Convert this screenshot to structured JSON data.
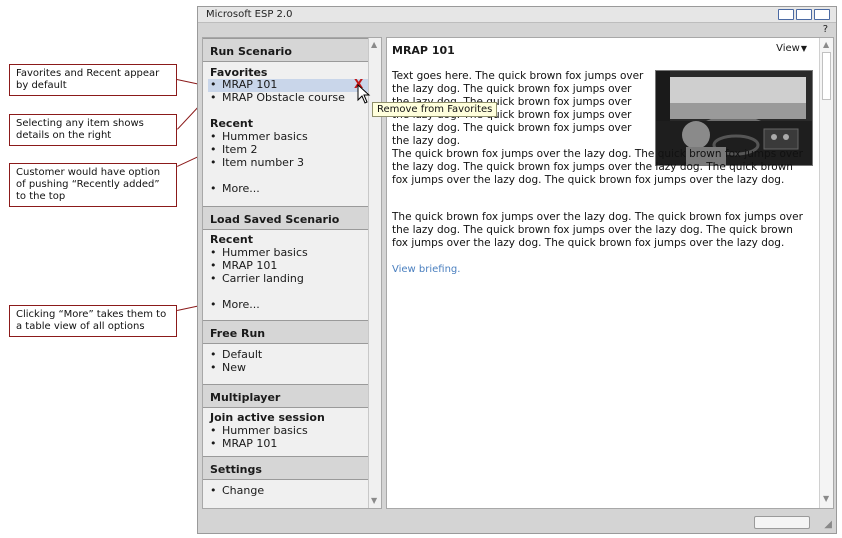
{
  "window": {
    "title": "Microsoft ESP 2.0",
    "help_label": "?"
  },
  "callouts": [
    "Favorites and Recent appear by default",
    "Selecting any item shows details on the right",
    "Customer would have option of pushing “Recently added” to the top",
    "Clicking “More” takes them to a table view of all options"
  ],
  "left_pane": {
    "run_scenario": {
      "header": "Run Scenario",
      "favorites_title": "Favorites",
      "favorites": [
        "MRAP 101",
        "MRAP Obstacle course"
      ],
      "remove_glyph": "X",
      "recent_title": "Recent",
      "recent": [
        "Hummer basics",
        "Item 2",
        "Item number 3"
      ],
      "more": "More..."
    },
    "load_saved": {
      "header": "Load Saved  Scenario",
      "recent_title": "Recent",
      "recent": [
        "Hummer basics",
        "MRAP 101",
        "Carrier landing"
      ],
      "more": "More..."
    },
    "free_run": {
      "header": "Free Run",
      "items": [
        "Default",
        "New"
      ]
    },
    "multiplayer": {
      "header": "Multiplayer",
      "join_title": "Join active session",
      "items": [
        "Hummer basics",
        "MRAP 101"
      ]
    },
    "settings": {
      "header": "Settings",
      "items": [
        "Change"
      ]
    },
    "bullet": "•"
  },
  "tooltip": "Remove from Favorites",
  "right_pane": {
    "title": "MRAP 101",
    "view_label": "View",
    "para1": "Text goes here.  The quick  brown fox jumps  over the lazy dog. The quick brown fox jumps over the lazy dog. The  quick  brown  fox  jumps  over  the  lazy  dog. The  quick  brown fox jumps over  the  lazy dog. The quick brown fox jumps over the lazy dog.",
    "para2": "The quick brown fox jumps over the lazy dog. The quick brown fox jumps over the lazy dog. The quick brown fox jumps over the lazy dog. The quick brown fox jumps over the lazy dog. The quick brown fox jumps over the lazy dog.",
    "para3": "The quick brown fox jumps over the lazy dog. The quick brown fox jumps over the lazy dog. The quick brown fox jumps over the lazy dog. The quick brown fox jumps over the lazy dog. The quick brown fox jumps over the lazy dog.",
    "link": "View briefing."
  },
  "colors": {
    "accent_link": "#4a7fbf",
    "callout_border": "#8b1a1a",
    "remove_x": "#c01818"
  }
}
